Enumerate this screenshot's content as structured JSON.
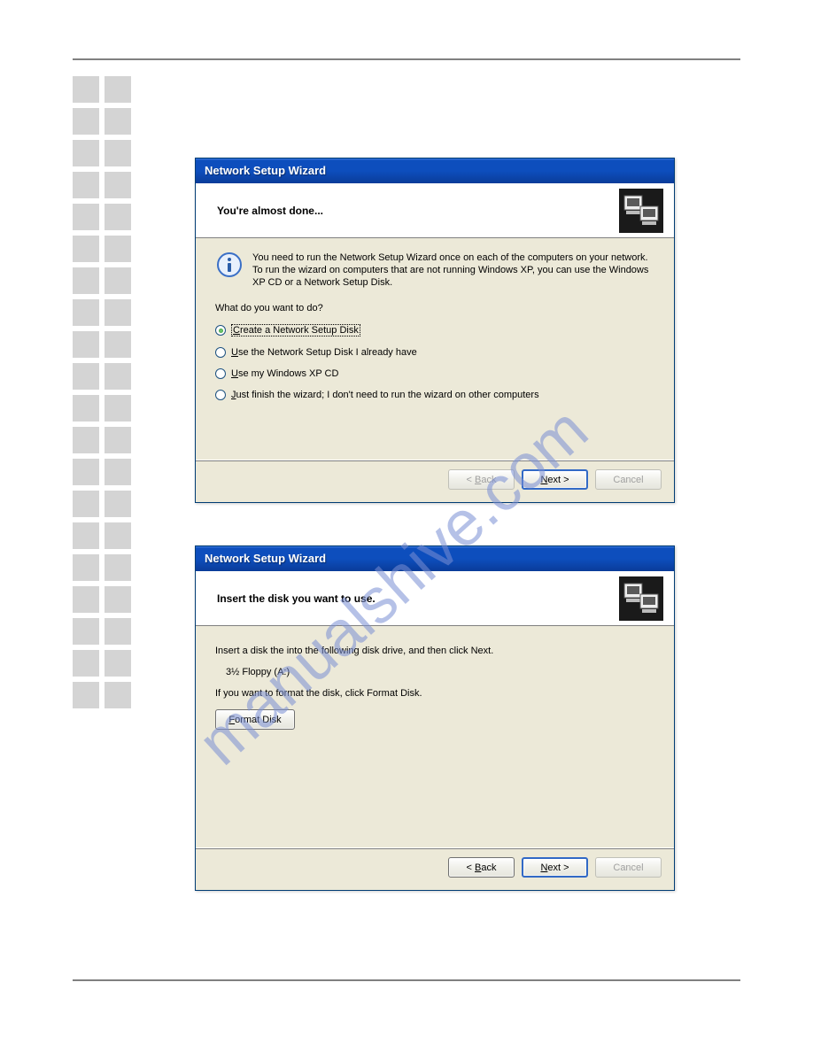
{
  "dialog1": {
    "title": "Network Setup Wizard",
    "header": "You're almost done...",
    "info": "You need to run the Network Setup Wizard once on each of the computers on your network. To run the wizard on computers that are not running Windows XP, you can use the Windows XP CD or a Network Setup Disk.",
    "prompt": "What do you want to do?",
    "options": {
      "opt1_pre": "C",
      "opt1_rest": "reate a Network Setup Disk",
      "opt2_pre": "U",
      "opt2_rest": "se the Network Setup Disk I already have",
      "opt3_pre": "U",
      "opt3_rest": "se my Windows XP CD",
      "opt4_pre": "J",
      "opt4_rest": "ust finish the wizard; I don't need to run the wizard on other computers"
    },
    "buttons": {
      "back_pre": "< ",
      "back_u": "B",
      "back_rest": "ack",
      "next_u": "N",
      "next_rest": "ext >",
      "cancel": "Cancel"
    }
  },
  "dialog2": {
    "title": "Network Setup Wizard",
    "header": "Insert the disk you want to use.",
    "line1": "Insert a disk the into the following disk drive, and then click Next.",
    "drive": "3½ Floppy (A:)",
    "line2": "If you want to format the disk, click Format Disk.",
    "format_btn_u": "F",
    "format_btn_rest": "ormat Disk",
    "buttons": {
      "back_pre": "< ",
      "back_u": "B",
      "back_rest": "ack",
      "next_u": "N",
      "next_rest": "ext >",
      "cancel": "Cancel"
    }
  },
  "watermark": "manualshive.com"
}
